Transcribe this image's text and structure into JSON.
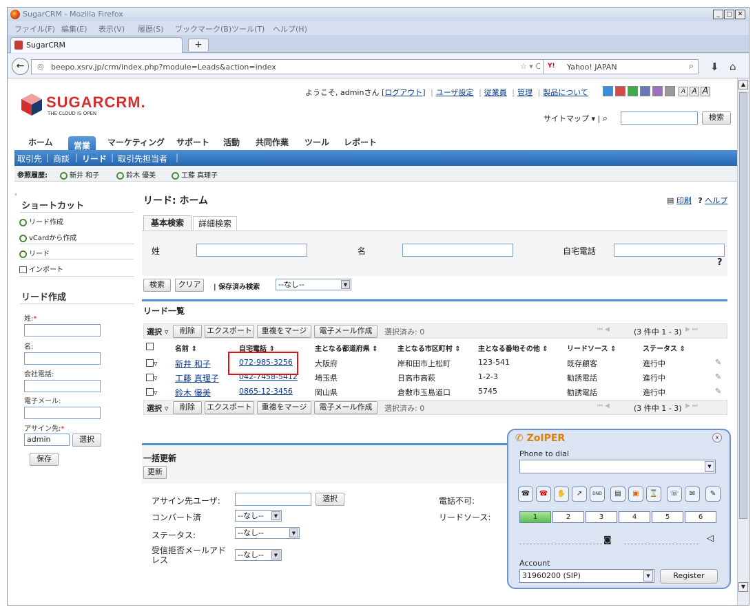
{
  "browser": {
    "title": "SugarCRM - Mozilla Firefox",
    "menu": [
      "ファイル(F)",
      "編集(E)",
      "表示(V)",
      "履歴(S)",
      "ブックマーク(B)",
      "ツール(T)",
      "ヘルプ(H)"
    ],
    "tab_label": "SugarCRM",
    "url": "beepo.xsrv.jp/crm/index.php?module=Leads&action=index",
    "search_engine": "Y!",
    "search_placeholder": "Yahoo! JAPAN"
  },
  "header": {
    "logo": "SUGARCRM.",
    "logo_sub": "THE CLOUD IS OPEN",
    "welcome": "ようこそ, adminさん",
    "logout": "ログアウト",
    "user_settings": "ユーザ設定",
    "employees": "従業員",
    "admin": "管理",
    "about": "製品について",
    "sitemap": "サイトマップ",
    "search_button": "検索",
    "font_sizes": [
      "A",
      "A",
      "A"
    ],
    "theme_colors": [
      "#3b8fd8",
      "#d24a4a",
      "#3faa4a",
      "#6b78b8",
      "#9c6fbf",
      "#999999"
    ]
  },
  "main_tabs": [
    "ホーム",
    "営業",
    "マーケティング",
    "サポート",
    "活動",
    "共同作業",
    "ツール",
    "レポート"
  ],
  "sub_tabs": [
    "取引先",
    "商談",
    "リード",
    "取引先担当者"
  ],
  "history": {
    "label": "参照履歴:",
    "items": [
      "新井 和子",
      "鈴木 優美",
      "工藤 真理子"
    ]
  },
  "sidebar": {
    "shortcuts_title": "ショートカット",
    "shortcuts": [
      "リード作成",
      "vCardから作成",
      "リード",
      "インポート"
    ],
    "quick_create_title": "リード作成",
    "fields": {
      "last_name": "姓:",
      "first_name": "名:",
      "office_phone": "会社電話:",
      "email": "電子メール:",
      "assigned_to": "アサイン先:",
      "assigned_value": "admin"
    },
    "required_mark": "*",
    "select_button": "選択",
    "save_button": "保存"
  },
  "main": {
    "title": "リード: ホーム",
    "print": "印刷",
    "help": "ヘルプ",
    "search_tabs": [
      "基本検索",
      "詳細検索"
    ],
    "search_fields": {
      "last_name": "姓",
      "first_name": "名",
      "home_phone": "自宅電話"
    },
    "help_mark": "?",
    "search_button": "検索",
    "clear_button": "クリア",
    "saved_search_label": "保存済み検索",
    "saved_search_value": "--なし--",
    "list_title": "リード一覧",
    "toolbar": {
      "select": "選択",
      "delete": "削除",
      "export": "エクスポート",
      "merge": "重複をマージ",
      "email": "電子メール作成",
      "selected": "選択済み: 0",
      "pagination": "(3 件中 1 - 3)"
    },
    "columns": [
      "名前",
      "自宅電話",
      "主となる都道府県",
      "主となる市区町村",
      "主となる番地その他",
      "リードソース",
      "ステータス"
    ],
    "rows": [
      {
        "name": "新井 和子",
        "phone": "072-985-3256",
        "pref": "大阪府",
        "city": "岸和田市上松町",
        "addr": "123-541",
        "source": "既存顧客",
        "status": "進行中"
      },
      {
        "name": "工藤 真理子",
        "phone": "042-7458-5412",
        "pref": "埼玉県",
        "city": "日高市高萩",
        "addr": "1-2-3",
        "source": "勧誘電話",
        "status": "進行中"
      },
      {
        "name": "鈴木 優美",
        "phone": "0865-12-3456",
        "pref": "岡山県",
        "city": "倉敷市玉島道口",
        "addr": "5745",
        "source": "勧誘電話",
        "status": "進行中"
      }
    ],
    "mass_update": {
      "title": "一括更新",
      "update_button": "更新",
      "assigned_user": "アサイン先ユーザ:",
      "select_button": "選択",
      "converted": "コンバート済",
      "status": "ステータス:",
      "opt_out": "受信拒否メールアドレス",
      "none": "--なし--",
      "do_not_call": "電話不可:",
      "lead_source": "リードソース:"
    }
  },
  "zoiper": {
    "logo": "ZoIPER",
    "phone_label": "Phone to dial",
    "lines": [
      "1",
      "2",
      "3",
      "4",
      "5",
      "6"
    ],
    "account_label": "Account",
    "account_value": "31960200 (SIP)",
    "register": "Register",
    "dnd": "DND"
  }
}
